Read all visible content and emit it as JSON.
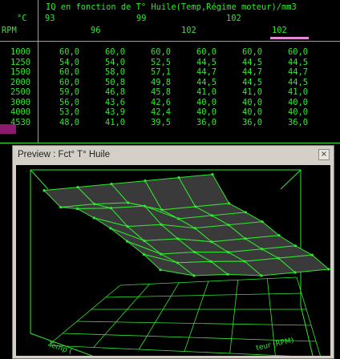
{
  "table": {
    "title": "IQ en fonction de T° Huile(Temp,Régime moteur)/mm3",
    "unit_label": "°C",
    "rpm_label": "RPM",
    "temp_row1": [
      "93",
      "99",
      "102"
    ],
    "temp_row2": [
      "96",
      "102",
      "102"
    ],
    "rows": [
      {
        "rpm": "1000",
        "values": [
          "60,0",
          "60,0",
          "60,0",
          "60,0",
          "60,0",
          "60,0"
        ]
      },
      {
        "rpm": "1250",
        "values": [
          "54,0",
          "54,0",
          "52,5",
          "44,5",
          "44,5",
          "44,5"
        ]
      },
      {
        "rpm": "1500",
        "values": [
          "60,0",
          "58,0",
          "57,1",
          "44,7",
          "44,7",
          "44,7"
        ]
      },
      {
        "rpm": "2000",
        "values": [
          "60,0",
          "50,8",
          "49,8",
          "44,5",
          "44,5",
          "44,5"
        ]
      },
      {
        "rpm": "2500",
        "values": [
          "59,0",
          "46,8",
          "45,8",
          "41,0",
          "41,0",
          "41,0"
        ]
      },
      {
        "rpm": "3000",
        "values": [
          "56,0",
          "43,6",
          "42,6",
          "40,0",
          "40,0",
          "40,0"
        ]
      },
      {
        "rpm": "4000",
        "values": [
          "53,0",
          "43,9",
          "42,4",
          "40,0",
          "40,0",
          "40,0"
        ]
      },
      {
        "rpm": "4530",
        "values": [
          "48,0",
          "41,0",
          "39,5",
          "36,0",
          "36,0",
          "36,0"
        ]
      }
    ]
  },
  "preview": {
    "title": "Preview : Fct° T° Huile",
    "close_glyph": "×",
    "axis_temp_label": "Temp (",
    "axis_rpm_label": "teur (RPM)"
  },
  "colors": {
    "grid_green": "#2fe82f",
    "surface_fill": "#3a3a3a",
    "selection": "#e38ad8",
    "row_highlight": "#8b1a6e"
  }
}
